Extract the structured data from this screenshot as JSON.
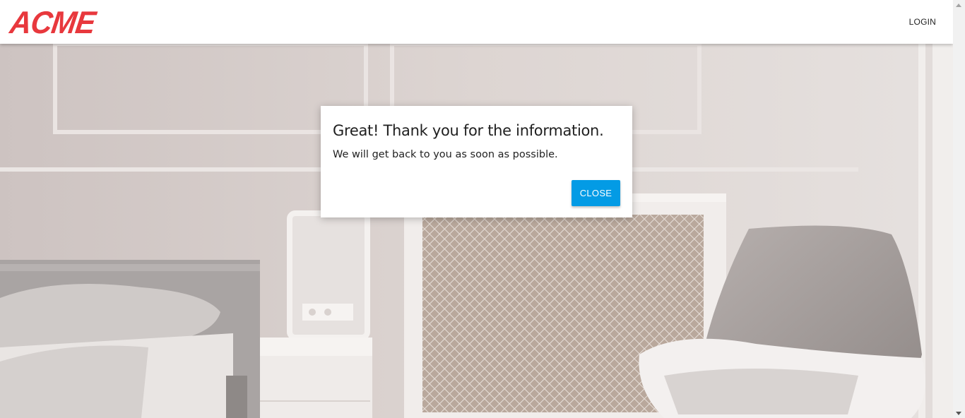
{
  "header": {
    "logo_text": "ACME",
    "login_label": "LOGIN"
  },
  "modal": {
    "title": "Great! Thank you for the information.",
    "message": "We will get back to you as soon as possible.",
    "close_label": "CLOSE"
  },
  "colors": {
    "brand": "#e8383d",
    "button": "#039be5"
  }
}
